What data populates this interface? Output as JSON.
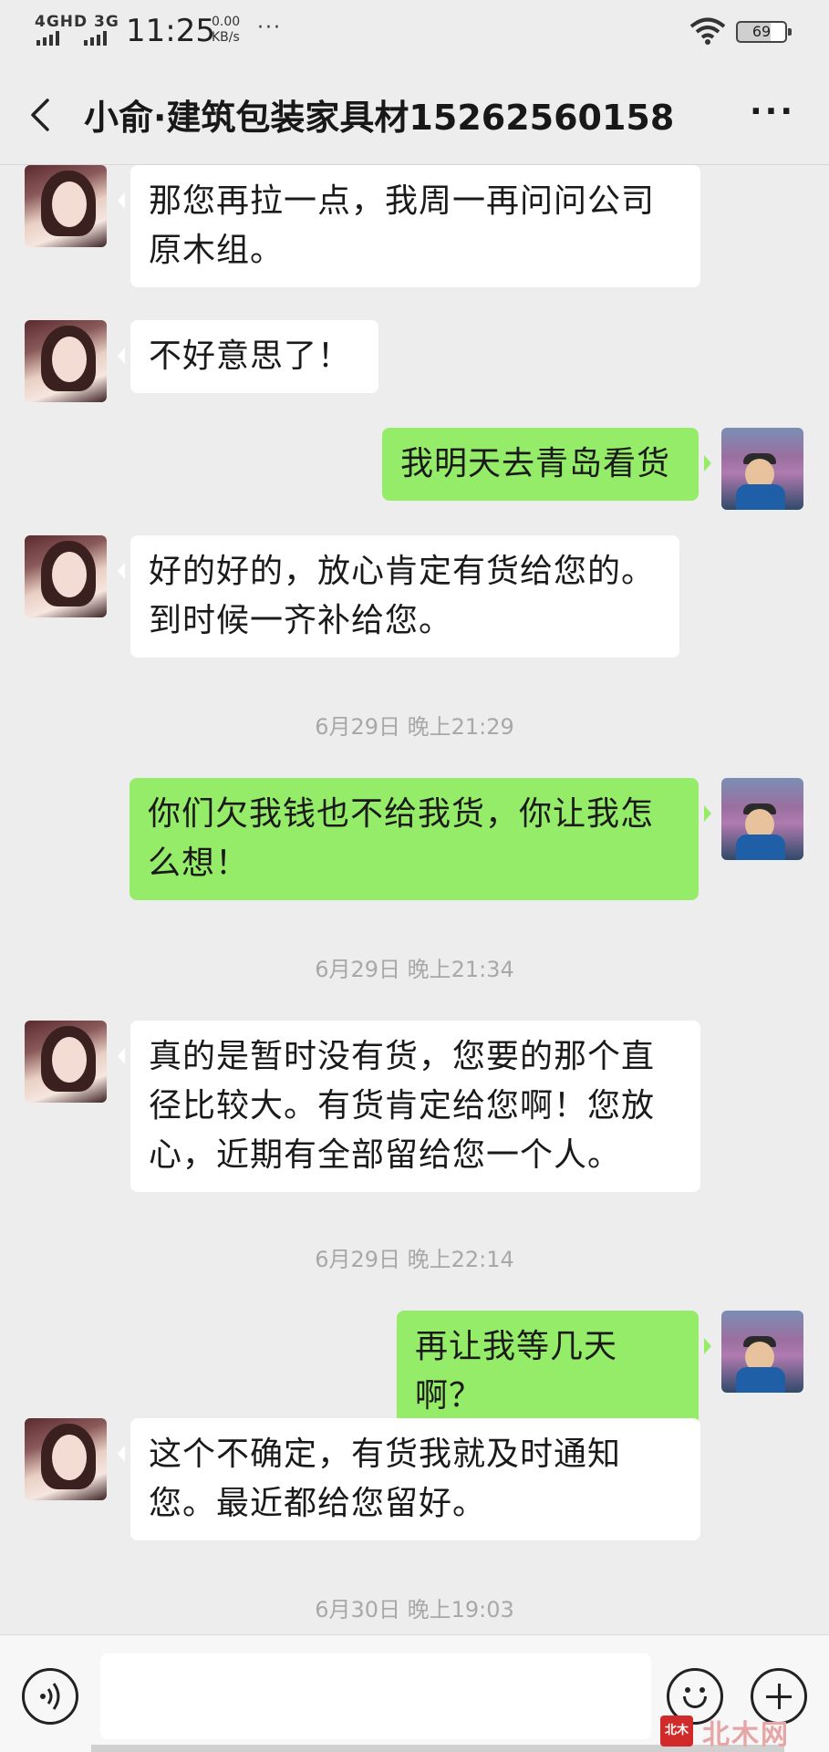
{
  "status_bar": {
    "network": "4GHD 3G",
    "time": "11:25",
    "speed_value": "0.00",
    "speed_unit": "KB/s",
    "more": "···",
    "battery": "69"
  },
  "header": {
    "title": "小俞·建筑包装家具材15262560158",
    "more_label": "···"
  },
  "messages": [
    {
      "side": "left",
      "text": "那您再拉一点，我周一再问问公司原木组。"
    },
    {
      "side": "left",
      "text": "不好意思了！"
    },
    {
      "side": "right",
      "text": "我明天去青岛看货"
    },
    {
      "side": "left",
      "text": "好的好的，放心肯定有货给您的。到时候一齐补给您。"
    },
    {
      "type": "time",
      "text": "6月29日 晚上21:29"
    },
    {
      "side": "right",
      "text": "你们欠我钱也不给我货，你让我怎么想！"
    },
    {
      "type": "time",
      "text": "6月29日 晚上21:34"
    },
    {
      "side": "left",
      "text": "真的是暂时没有货，您要的那个直径比较大。有货肯定给您啊！您放心，近期有全部留给您一个人。"
    },
    {
      "type": "time",
      "text": "6月29日 晚上22:14"
    },
    {
      "side": "right",
      "text": "再让我等几天啊？"
    },
    {
      "side": "left",
      "text": "这个不确定，有货我就及时通知您。最近都给您留好。"
    },
    {
      "type": "time",
      "text": "6月30日 晚上19:03"
    }
  ],
  "watermark": {
    "logo": "北木",
    "text": "北木网"
  },
  "colors": {
    "background": "#ededed",
    "bubble_self": "#95ec69",
    "bubble_other": "#ffffff"
  },
  "icons": [
    "back-icon",
    "more-icon",
    "voice-icon",
    "emoji-icon",
    "plus-icon",
    "wifi-icon",
    "battery-icon"
  ]
}
